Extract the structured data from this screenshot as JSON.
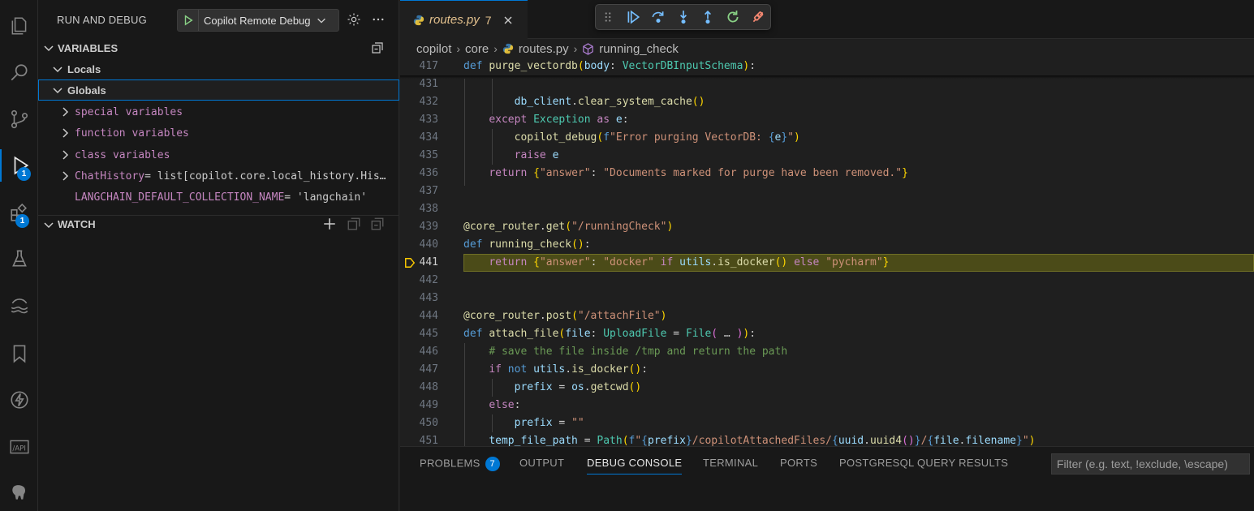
{
  "activity_bar": {
    "run_debug_badge": "1",
    "extensions_badge": "1"
  },
  "sidebar": {
    "title": "RUN AND DEBUG",
    "launch_config": "Copilot Remote Debug",
    "variables_header": "VARIABLES",
    "locals_label": "Locals",
    "globals_label": "Globals",
    "items": [
      {
        "name": "special variables",
        "value": "",
        "expandable": true
      },
      {
        "name": "function variables",
        "value": "",
        "expandable": true
      },
      {
        "name": "class variables",
        "value": "",
        "expandable": true
      },
      {
        "name": "ChatHistory",
        "value": " = list[copilot.core.local_history.His…",
        "expandable": true
      },
      {
        "name": "LANGCHAIN_DEFAULT_COLLECTION_NAME",
        "value": " = 'langchain'",
        "expandable": false
      }
    ],
    "watch_header": "WATCH"
  },
  "editor": {
    "tab_name": "routes.py",
    "tab_problems": "7",
    "breadcrumb": [
      "copilot",
      "core",
      "routes.py",
      "running_check"
    ],
    "sticky_line": "417",
    "current_line": "441",
    "line_numbers": [
      "431",
      "432",
      "433",
      "434",
      "435",
      "436",
      "437",
      "438",
      "439",
      "440",
      "441",
      "442",
      "443",
      "444",
      "445",
      "446",
      "447",
      "448",
      "449",
      "450",
      "451"
    ]
  },
  "panel": {
    "tabs": [
      "PROBLEMS",
      "OUTPUT",
      "DEBUG CONSOLE",
      "TERMINAL",
      "PORTS",
      "POSTGRESQL QUERY RESULTS"
    ],
    "problems_count": "7",
    "active_tab": "DEBUG CONSOLE",
    "filter_placeholder": "Filter (e.g. text, !exclude, \\escape)"
  },
  "colors": {
    "accent": "#0078d4",
    "current_line_bg": "#4b4b18",
    "tab_modified": "#e2c08d"
  }
}
